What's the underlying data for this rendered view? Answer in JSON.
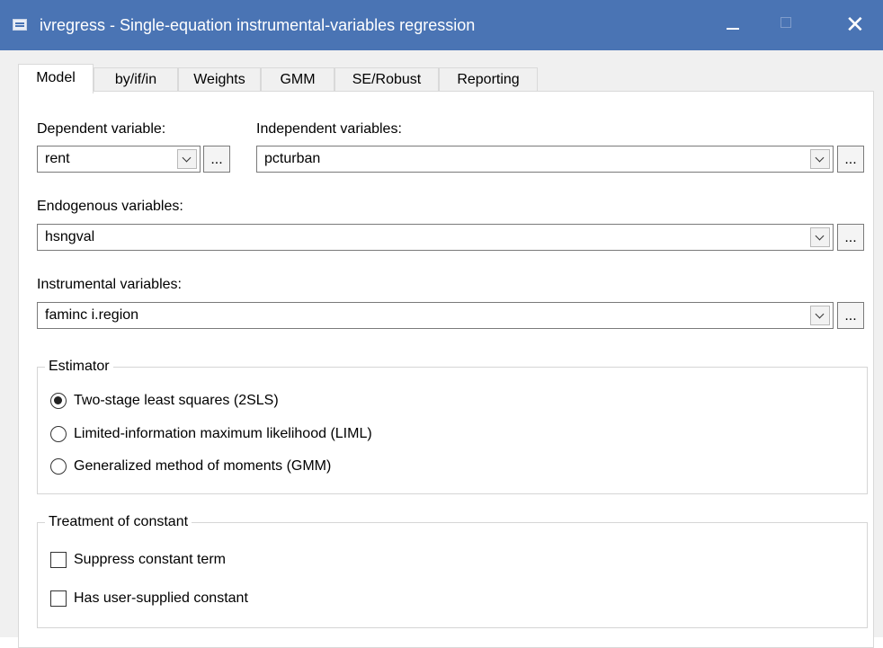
{
  "window": {
    "title": "ivregress - Single-equation instrumental-variables regression",
    "close_glyph": "✕"
  },
  "tabs": [
    {
      "label": "Model",
      "active": true
    },
    {
      "label": "by/if/in"
    },
    {
      "label": "Weights"
    },
    {
      "label": "GMM"
    },
    {
      "label": "SE/Robust"
    },
    {
      "label": "Reporting"
    }
  ],
  "model": {
    "dependent": {
      "label": "Dependent variable:",
      "value": "rent"
    },
    "independent": {
      "label": "Independent variables:",
      "value": "pcturban"
    },
    "endogenous": {
      "label": "Endogenous variables:",
      "value": "hsngval"
    },
    "instrumental": {
      "label": "Instrumental variables:",
      "value": "faminc i.region"
    },
    "ellipsis_label": "...",
    "estimator": {
      "legend": "Estimator",
      "options": [
        {
          "label": "Two-stage least squares (2SLS)",
          "selected": true
        },
        {
          "label": "Limited-information maximum likelihood (LIML)",
          "selected": false
        },
        {
          "label": "Generalized method of moments (GMM)",
          "selected": false
        }
      ]
    },
    "constant": {
      "legend": "Treatment of constant",
      "options": [
        {
          "label": "Suppress constant term",
          "checked": false
        },
        {
          "label": "Has user-supplied constant",
          "checked": false
        }
      ]
    }
  }
}
